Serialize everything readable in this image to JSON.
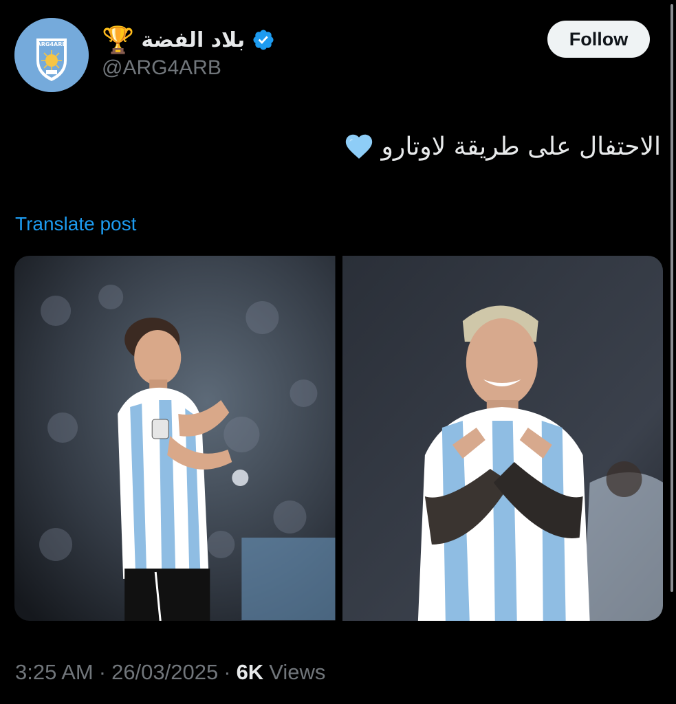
{
  "author": {
    "avatar_text": "ARG4ARB",
    "display_name": "بلاد الفضة",
    "trophy_emoji": "🏆",
    "handle": "@ARG4ARB",
    "verified": true
  },
  "follow_label": "Follow",
  "tweet": {
    "text": "الاحتفال على طريقة لاوتارو",
    "emoji": "light-blue-heart"
  },
  "translate_label": "Translate post",
  "media": [
    {
      "description_icon": "photo-player-celebration-left"
    },
    {
      "description_icon": "photo-player-celebration-right"
    }
  ],
  "meta": {
    "time": "3:25 AM",
    "sep1": "·",
    "date": "26/03/2025",
    "sep2": "·",
    "views_count": "6K",
    "views_label": "Views"
  },
  "colors": {
    "accent": "#1d9bf0",
    "verified": "#1d9bf0",
    "background": "#000000",
    "secondary_text": "#71767b",
    "argentina_blue": "#75aadb"
  }
}
